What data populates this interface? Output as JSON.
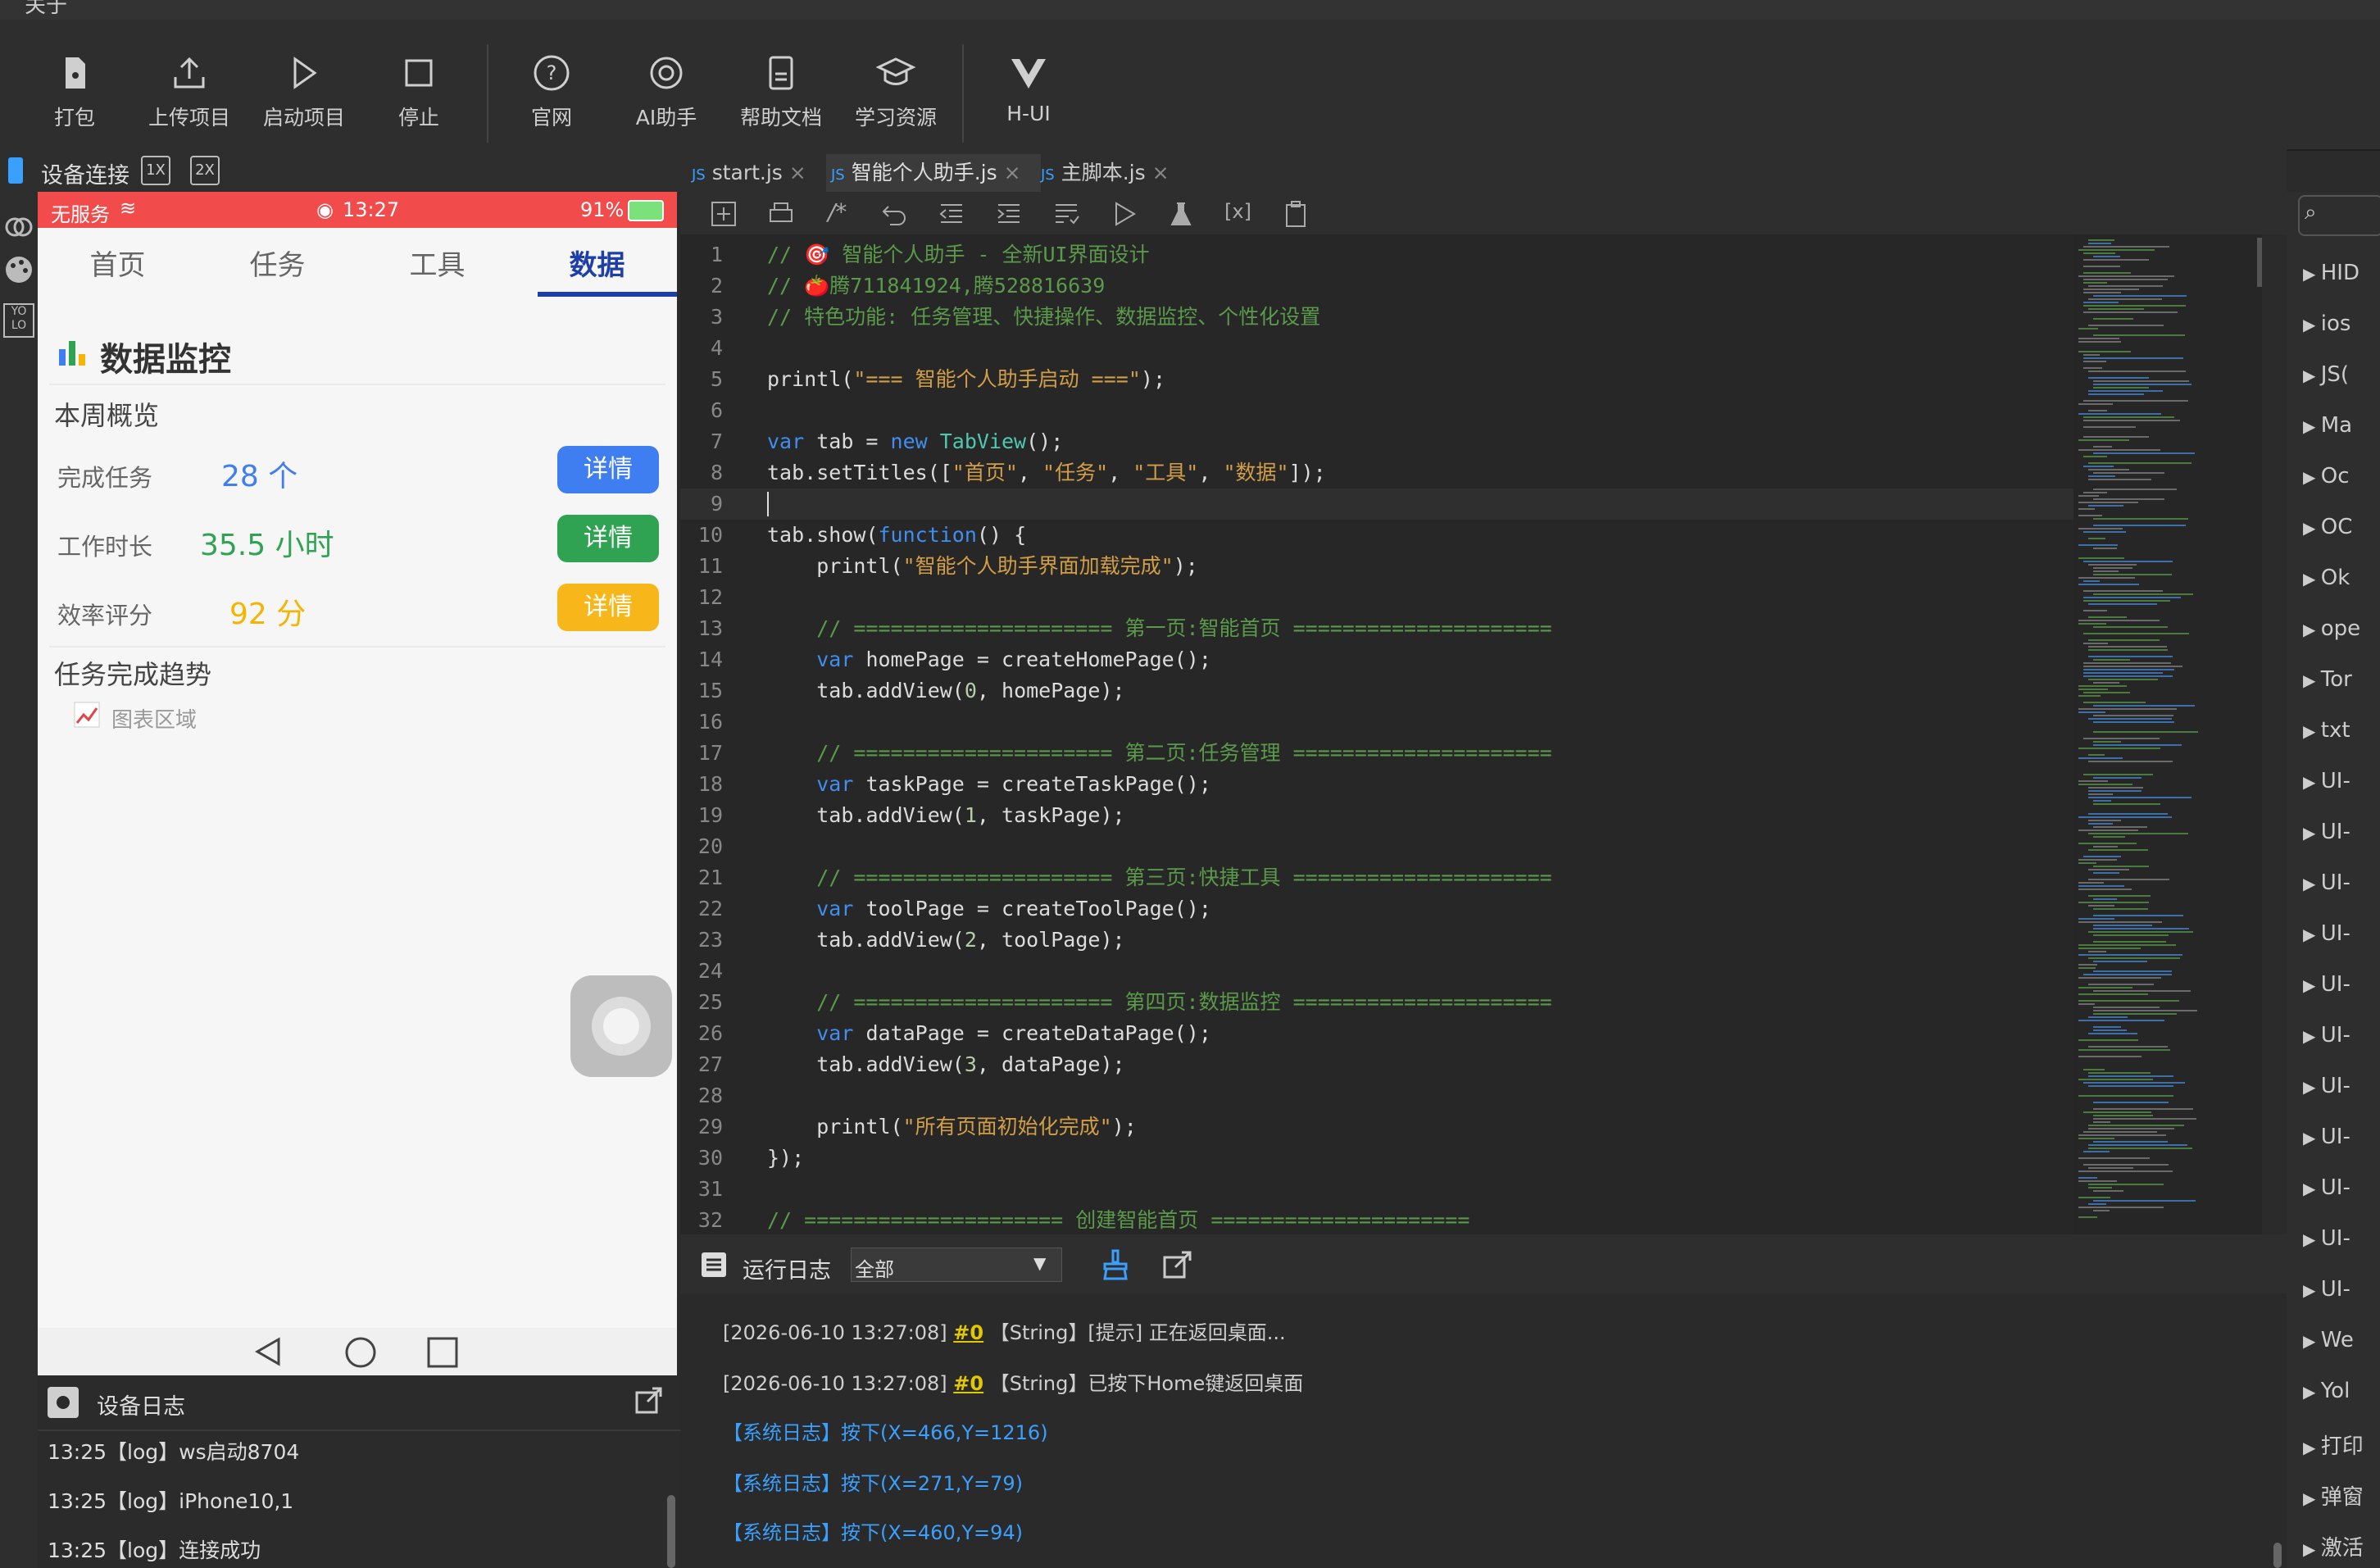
{
  "menu": {
    "about": "关于"
  },
  "toolbar": {
    "buttons": [
      {
        "label": "打包"
      },
      {
        "label": "上传项目"
      },
      {
        "label": "启动项目"
      },
      {
        "label": "停止"
      },
      {
        "label": "官网"
      },
      {
        "label": "AI助手"
      },
      {
        "label": "帮助文档"
      },
      {
        "label": "学习资源"
      },
      {
        "label": "H-UI"
      }
    ]
  },
  "device_panel": {
    "title": "设备连接",
    "zoom_1x": "1X",
    "zoom_2x": "2X",
    "rail_icon_label": "YO LO"
  },
  "phone": {
    "status": {
      "carrier": "无服务",
      "time": "13:27",
      "battery": "91%"
    },
    "tabs": [
      "首页",
      "任务",
      "工具",
      "数据"
    ],
    "active_tab": "数据",
    "section_title": "数据监控",
    "week_overview": "本周概览",
    "rows": [
      {
        "label": "完成任务",
        "value": "28 个",
        "button": "详情",
        "color": "#3f7ef0",
        "btn_color": "#3f7ef0"
      },
      {
        "label": "工作时长",
        "value": "35.5 小时",
        "button": "详情",
        "color": "#2fa352",
        "btn_color": "#2fa352"
      },
      {
        "label": "效率评分",
        "value": "92 分",
        "button": "详情",
        "color": "#f4b400",
        "btn_color": "#f7b71a"
      }
    ],
    "trend_title": "任务完成趋势",
    "chart_placeholder": "图表区域"
  },
  "device_log": {
    "title": "设备日志",
    "lines": [
      "13:25【log】ws启动8704",
      "13:25【log】iPhone10,1",
      "13:25【log】连接成功"
    ]
  },
  "editor": {
    "tabs": [
      {
        "label": "start.js",
        "active": false
      },
      {
        "label": "智能个人助手.js",
        "active": true
      },
      {
        "label": "主脚本.js",
        "active": false
      }
    ],
    "current_line": 9,
    "cursor_col": 1
  },
  "code_lines": [
    "// 🎯 智能个人助手 - 全新UI界面设计",
    "// 🍅腾711841924,腾528816639",
    "// 特色功能: 任务管理、快捷操作、数据监控、个性化设置",
    "",
    "printl(\"=== 智能个人助手启动 ===\");",
    "",
    "var tab = new TabView();",
    "tab.setTitles([\"首页\", \"任务\", \"工具\", \"数据\"]);",
    "",
    "tab.show(function() {",
    "    printl(\"智能个人助手界面加载完成\");",
    "",
    "    // ===================== 第一页:智能首页 =====================",
    "    var homePage = createHomePage();",
    "    tab.addView(0, homePage);",
    "",
    "    // ===================== 第二页:任务管理 =====================",
    "    var taskPage = createTaskPage();",
    "    tab.addView(1, taskPage);",
    "",
    "    // ===================== 第三页:快捷工具 =====================",
    "    var toolPage = createToolPage();",
    "    tab.addView(2, toolPage);",
    "",
    "    // ===================== 第四页:数据监控 =====================",
    "    var dataPage = createDataPage();",
    "    tab.addView(3, dataPage);",
    "",
    "    printl(\"所有页面初始化完成\");",
    "});",
    "",
    "// ===================== 创建智能首页 ====================="
  ],
  "right_panel": {
    "items": [
      "HID",
      "ios",
      "JS(",
      "Ma",
      "Oc",
      "OC",
      "Ok",
      "ope",
      "Tor",
      "txt",
      "UI-",
      "UI-",
      "UI-",
      "UI-",
      "UI-",
      "UI-",
      "UI-",
      "UI-",
      "UI-",
      "UI-",
      "UI-",
      "We",
      "Yol",
      "打印",
      "弹窗",
      "激活"
    ]
  },
  "run_log": {
    "title": "运行日志",
    "filter": "全部",
    "lines": [
      {
        "date": "[2026-06-10 13:27:08]",
        "tag": "#0",
        "text": "【String】[提示] 正在返回桌面..."
      },
      {
        "date": "[2026-06-10 13:27:08]",
        "tag": "#0",
        "text": "【String】已按下Home键返回桌面"
      },
      {
        "system": "【系统日志】按下(X=466,Y=1216)"
      },
      {
        "system": "【系统日志】按下(X=271,Y=79)"
      },
      {
        "system": "【系统日志】按下(X=460,Y=94)"
      }
    ]
  }
}
